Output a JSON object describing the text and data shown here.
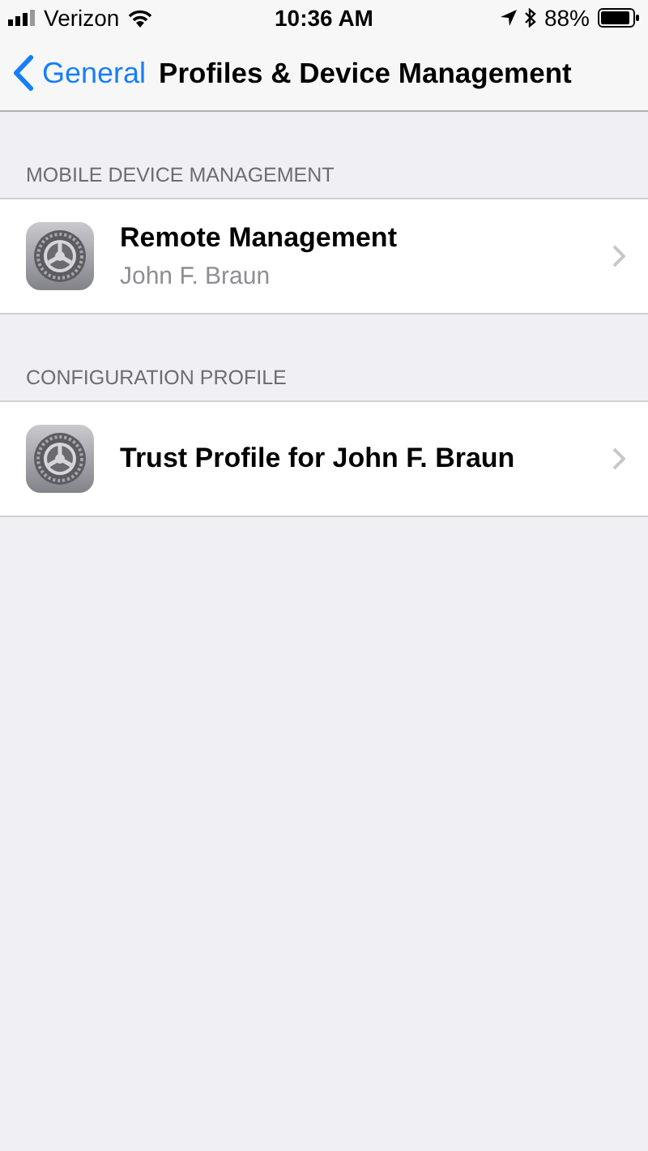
{
  "status_bar": {
    "carrier": "Verizon",
    "time": "10:36 AM",
    "battery": "88%"
  },
  "nav": {
    "back": "General",
    "title": "Profiles & Device Management"
  },
  "sections": [
    {
      "header": "MOBILE DEVICE MANAGEMENT",
      "items": [
        {
          "title": "Remote Management",
          "subtitle": "John F. Braun"
        }
      ]
    },
    {
      "header": "CONFIGURATION PROFILE",
      "items": [
        {
          "title": "Trust Profile for John F. Braun"
        }
      ]
    }
  ]
}
